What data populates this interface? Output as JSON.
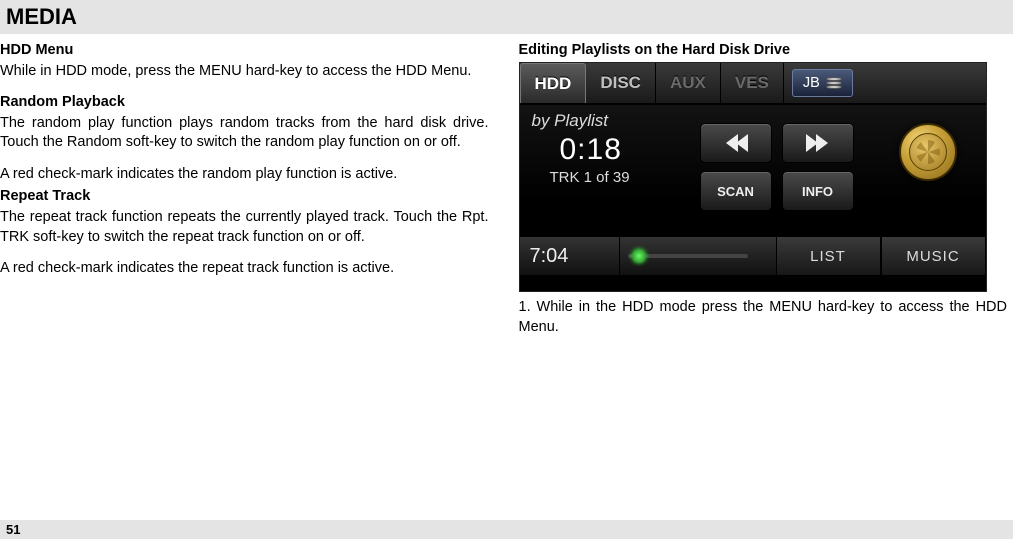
{
  "header": {
    "title": "MEDIA"
  },
  "left": {
    "h1": "HDD Menu",
    "p1": "While in HDD mode, press the MENU hard-key to access the HDD Menu.",
    "h2": "Random Playback",
    "p2": "The random play function plays random tracks from the hard disk drive. Touch the Random soft-key to switch the random play function on or off.",
    "p3": "A red check-mark indicates the random play function is active.",
    "h3": "Repeat Track",
    "p4": "The repeat track function repeats the currently played track. Touch the Rpt. TRK soft-key to switch the repeat track function on or off.",
    "p5": "A red check-mark indicates the repeat track function is active."
  },
  "right": {
    "h1": "Editing Playlists on the Hard Disk Drive",
    "caption": "1. While in the HDD mode press the MENU hard-key to access the HDD Menu."
  },
  "screenshot": {
    "tabs": {
      "hdd": "HDD",
      "disc": "DISC",
      "aux": "AUX",
      "ves": "VES",
      "jb": "JB"
    },
    "now_playing": {
      "mode": "by Playlist",
      "time": "0:18",
      "track": "TRK 1 of 39"
    },
    "buttons": {
      "scan": "SCAN",
      "info": "INFO",
      "list": "LIST",
      "music": "MUSIC"
    },
    "clock": "7:04"
  },
  "footer": {
    "page": "51"
  }
}
